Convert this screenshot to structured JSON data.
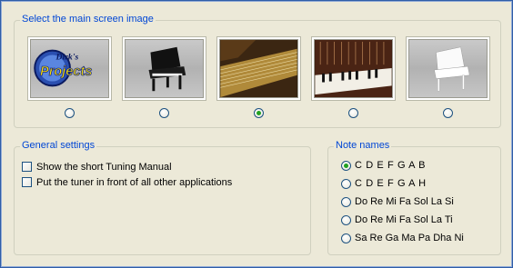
{
  "main_image": {
    "legend": "Select the main screen image",
    "options": [
      {
        "icon": "dirk-projects-logo-icon",
        "checked": false,
        "logo_text_top": "Dirk's",
        "logo_text_main": "Projects"
      },
      {
        "icon": "black-grand-piano-icon",
        "checked": false
      },
      {
        "icon": "piano-strings-interior-icon",
        "checked": true
      },
      {
        "icon": "upright-piano-keys-icon",
        "checked": false
      },
      {
        "icon": "white-grand-piano-icon",
        "checked": false
      }
    ]
  },
  "general_settings": {
    "legend": "General settings",
    "options": [
      {
        "label": "Show the short Tuning Manual",
        "checked": false
      },
      {
        "label": "Put the tuner in front of all other applications",
        "checked": false
      }
    ]
  },
  "note_names": {
    "legend": "Note names",
    "options": [
      {
        "label": "C D E F G A B",
        "checked": true
      },
      {
        "label": "C D E F G A H",
        "checked": false
      },
      {
        "label": "Do Re Mi Fa Sol La Si",
        "checked": false
      },
      {
        "label": "Do Re Mi Fa Sol La Ti",
        "checked": false
      },
      {
        "label": "Sa Re Ga Ma Pa Dha Ni",
        "checked": false
      }
    ]
  },
  "colors": {
    "legend": "#0046d5",
    "background": "#ece9d8",
    "radio_dot": "#21a121"
  }
}
